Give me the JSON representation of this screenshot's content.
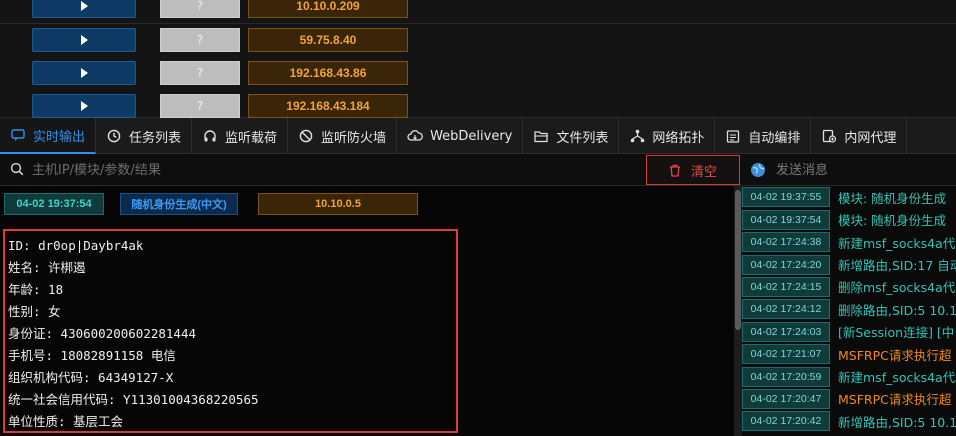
{
  "sessions": [
    {
      "os": "?",
      "ip": "10.10.0.209"
    },
    {
      "os": "?",
      "ip": "59.75.8.40"
    },
    {
      "os": "?",
      "ip": "192.168.43.86"
    },
    {
      "os": "?",
      "ip": "192.168.43.184"
    }
  ],
  "tabs": [
    {
      "label": "实时输出",
      "icon": "chat-icon",
      "active": true
    },
    {
      "label": "任务列表",
      "icon": "clock-icon"
    },
    {
      "label": "监听载荷",
      "icon": "headphones-icon"
    },
    {
      "label": "监听防火墙",
      "icon": "block-icon"
    },
    {
      "label": "WebDelivery",
      "icon": "cloud-icon"
    },
    {
      "label": "文件列表",
      "icon": "folder-icon"
    },
    {
      "label": "网络拓扑",
      "icon": "network-icon"
    },
    {
      "label": "自动编排",
      "icon": "calendar-icon"
    },
    {
      "label": "内网代理",
      "icon": "proxy-icon"
    }
  ],
  "filter": {
    "search_placeholder": "主机IP/模块/参数/结果",
    "clear_label": "清空",
    "send_placeholder": "发送消息"
  },
  "output": {
    "time": "04-02 19:37:54",
    "module": "随机身份生成(中文)",
    "ip": "10.10.0.5",
    "lines": [
      "ID: dr0op|Daybr4ak",
      "姓名: 许梆遏",
      "年龄: 18",
      "性别: 女",
      "身份证: 430600200602281444",
      "手机号: 18082891158 电信",
      "组织机构代码: 64349127-X",
      "统一社会信用代码: Y11301004368220565",
      "单位性质: 基层工会"
    ]
  },
  "logs": [
    {
      "time": "04-02 19:37:55",
      "msg": "模块: 随机身份生成",
      "color": "teal"
    },
    {
      "time": "04-02 19:37:54",
      "msg": "模块: 随机身份生成",
      "color": "teal"
    },
    {
      "time": "04-02 17:24:38",
      "msg": "新建msf_socks4a代",
      "color": "teal"
    },
    {
      "time": "04-02 17:24:20",
      "msg": "新增路由,SID:17 自动",
      "color": "teal"
    },
    {
      "time": "04-02 17:24:15",
      "msg": "删除msf_socks4a代",
      "color": "teal"
    },
    {
      "time": "04-02 17:24:12",
      "msg": "删除路由,SID:5 10.1",
      "color": "teal"
    },
    {
      "time": "04-02 17:24:03",
      "msg": "[新Session连接] [中",
      "color": "teal"
    },
    {
      "time": "04-02 17:21:07",
      "msg": "MSFRPC请求执行超",
      "color": "orange"
    },
    {
      "time": "04-02 17:20:59",
      "msg": "新建msf_socks4a代",
      "color": "teal"
    },
    {
      "time": "04-02 17:20:47",
      "msg": "MSFRPC请求执行超",
      "color": "orange"
    },
    {
      "time": "04-02 17:20:42",
      "msg": "新增路由,SID:5 10.1",
      "color": "teal"
    }
  ],
  "colors": {
    "accent": "#2f8fe6",
    "danger": "#e0393d",
    "teal": "#35c3b4",
    "orange": "#f08a1c"
  }
}
